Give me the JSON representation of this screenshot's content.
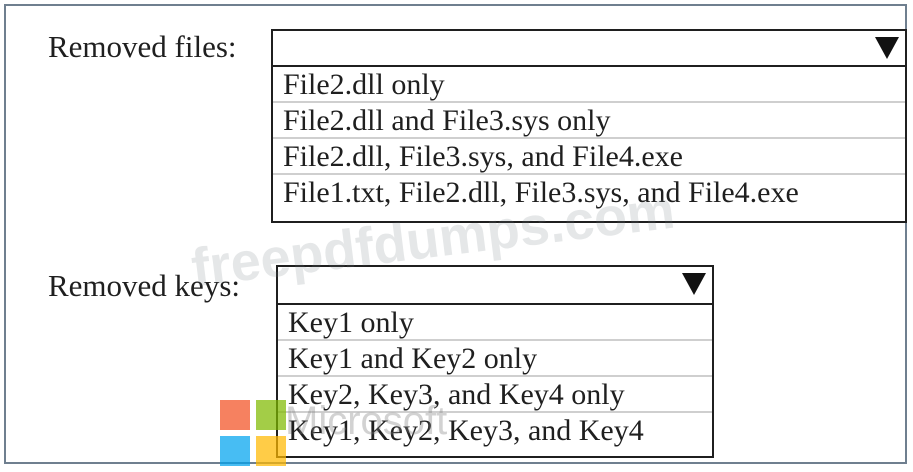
{
  "removed_files": {
    "label": "Removed files:",
    "selected": "",
    "options": [
      "File2.dll only",
      "File2.dll and File3.sys only",
      "File2.dll, File3.sys, and File4.exe",
      "File1.txt, File2.dll, File3.sys, and File4.exe"
    ]
  },
  "removed_keys": {
    "label": "Removed keys:",
    "selected": "",
    "options": [
      "Key1 only",
      "Key1 and Key2 only",
      "Key2, Key3, and Key4 only",
      "Key1, Key2, Key3, and Key4"
    ]
  },
  "watermarks": {
    "site": "freepdfdumps.com",
    "brand": "Microsoft"
  },
  "icons": {
    "dropdown": "chevron-down-icon",
    "logo": "microsoft-logo"
  },
  "colors": {
    "frame_border": "#6f7f8f",
    "text": "#1f1f1f",
    "option_divider": "#cfcfcf",
    "microsoft_red": "#f25022",
    "microsoft_green": "#7fba00",
    "microsoft_blue": "#00a4ef",
    "microsoft_yellow": "#ffb900"
  }
}
